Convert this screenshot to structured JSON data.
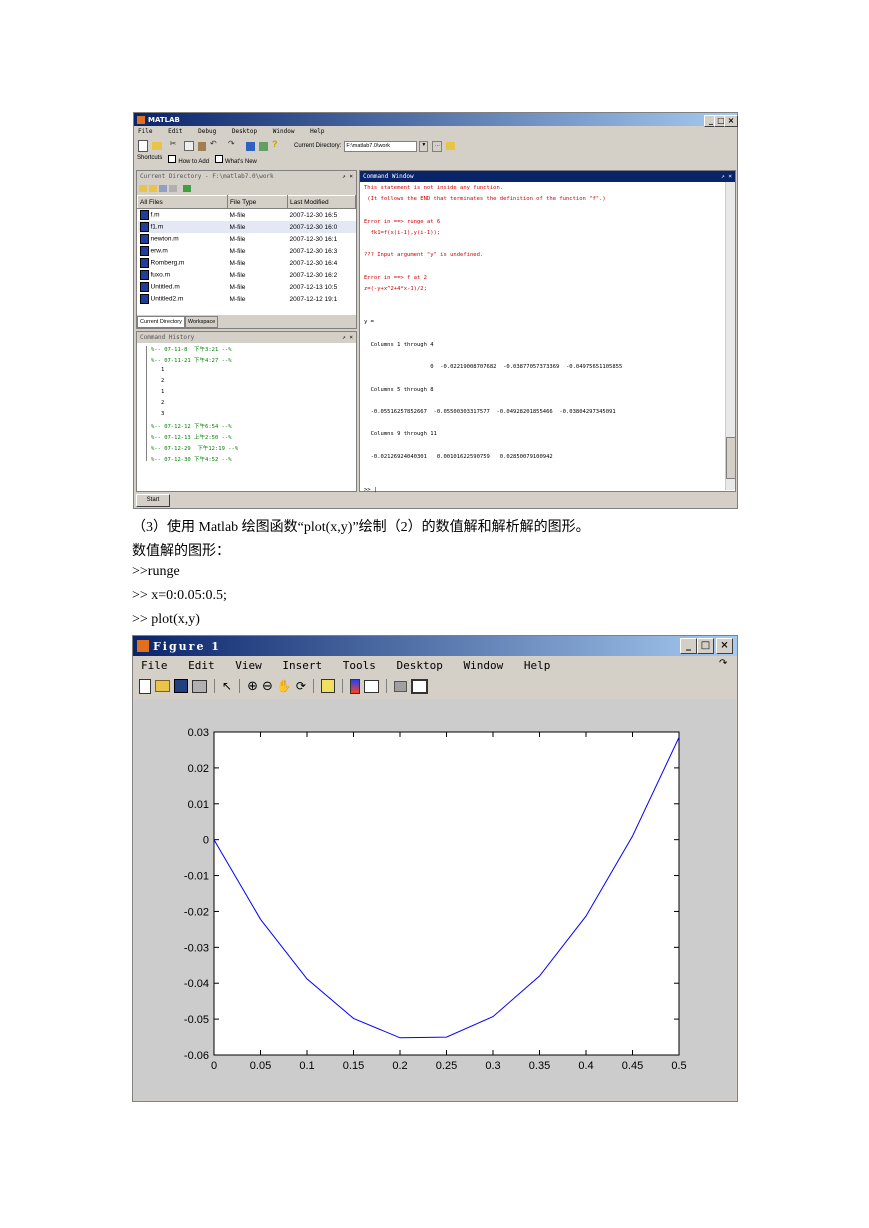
{
  "matlab": {
    "title": "MATLAB",
    "menu": [
      "File",
      "Edit",
      "Debug",
      "Desktop",
      "Window",
      "Help"
    ],
    "current_directory_label": "Current Directory:",
    "current_directory_value": "F:\\matlab7.0\\work",
    "shortcuts": [
      "Shortcuts",
      "How to Add",
      "What's New"
    ],
    "current_dir_panel_title": "Current Directory - F:\\matlab7.0\\work",
    "file_columns": [
      "All Files",
      "File Type",
      "Last Modified"
    ],
    "files": [
      {
        "name": "f.m",
        "type": "M-file",
        "modified": "2007-12-30 16:5"
      },
      {
        "name": "f1.m",
        "type": "M-file",
        "modified": "2007-12-30 16:0"
      },
      {
        "name": "newton.m",
        "type": "M-file",
        "modified": "2007-12-30 16:1"
      },
      {
        "name": "erw.m",
        "type": "M-file",
        "modified": "2007-12-30 16:3"
      },
      {
        "name": "Romberg.m",
        "type": "M-file",
        "modified": "2007-12-30 16:4"
      },
      {
        "name": "fuxo.m",
        "type": "M-file",
        "modified": "2007-12-30 16:2"
      },
      {
        "name": "Untitled.m",
        "type": "M-file",
        "modified": "2007-12-13 10:5"
      },
      {
        "name": "Untitled2.m",
        "type": "M-file",
        "modified": "2007-12-12 19:1"
      }
    ],
    "panel_tabs": [
      "Current Directory",
      "Workspace"
    ],
    "history_title": "Command History",
    "history": [
      "%-- 07-11-8  下午3:21 --%",
      "%-- 07-11-21 下午4:27 --%",
      "1",
      "2",
      "1",
      "2",
      "3",
      "%-- 07-12-12 下午6:54 --%",
      "%-- 07-12-13 上午2:50 --%",
      "%-- 07-12-29  下午12:19 --%",
      "%-- 07-12-30 下午4:52 --%"
    ],
    "command_title": "Command Window",
    "command_lines": [
      {
        "text": "This statement is not inside any function.",
        "red": true
      },
      {
        "text": " (It follows the END that terminates the definition of the function \"f\".)",
        "red": true
      },
      {
        "text": "",
        "red": false
      },
      {
        "text": "Error in ==> runge at 6",
        "red": true
      },
      {
        "text": "  fk1=f(x(i-1),y(i-1));",
        "red": true
      },
      {
        "text": "",
        "red": false
      },
      {
        "text": "??? Input argument \"y\" is undefined.",
        "red": true
      },
      {
        "text": "",
        "red": false
      },
      {
        "text": "Error in ==> f at 2",
        "red": true
      },
      {
        "text": "z=(-y+x^2+4*x-1)/2;",
        "red": true
      },
      {
        "text": "",
        "red": false
      },
      {
        "text": "",
        "red": false
      },
      {
        "text": "y =",
        "red": false
      },
      {
        "text": "",
        "red": false
      },
      {
        "text": "  Columns 1 through 4",
        "red": false
      },
      {
        "text": "",
        "red": false
      },
      {
        "text": "                    0  -0.02219008707682  -0.03877057373369  -0.04975651105855",
        "red": false
      },
      {
        "text": "",
        "red": false
      },
      {
        "text": "  Columns 5 through 8",
        "red": false
      },
      {
        "text": "",
        "red": false
      },
      {
        "text": "  -0.05516257852667  -0.05500303317577  -0.04928201855466  -0.03804297345091",
        "red": false
      },
      {
        "text": "",
        "red": false
      },
      {
        "text": "  Columns 9 through 11",
        "red": false
      },
      {
        "text": "",
        "red": false
      },
      {
        "text": "  -0.02126924040301   0.00101622590759   0.02850079100942",
        "red": false
      },
      {
        "text": "",
        "red": false
      },
      {
        "text": "",
        "red": false
      },
      {
        "text": ">> |",
        "red": false
      }
    ],
    "start_label": "Start"
  },
  "doc": {
    "line1": "（3）使用 Matlab 绘图函数“plot(x,y)”绘制（2）的数值解和解析解的图形。",
    "line2": "数值解的图形：",
    "line3": ">>runge",
    "line4": ">> x=0:0.05:0.5;",
    "line5": ">> plot(x,y)"
  },
  "figure": {
    "title": "Figure 1",
    "menu": [
      "File",
      "Edit",
      "View",
      "Insert",
      "Tools",
      "Desktop",
      "Window",
      "Help"
    ]
  },
  "chart_data": {
    "type": "line",
    "x": [
      0,
      0.05,
      0.1,
      0.15,
      0.2,
      0.25,
      0.3,
      0.35,
      0.4,
      0.45,
      0.5
    ],
    "series": [
      {
        "values": [
          0,
          -0.0222,
          -0.0388,
          -0.0498,
          -0.0552,
          -0.055,
          -0.0493,
          -0.038,
          -0.0213,
          0.001,
          0.0285
        ],
        "color": "#0000ff"
      }
    ],
    "xlim": [
      0,
      0.5
    ],
    "ylim": [
      -0.06,
      0.03
    ],
    "xticks": [
      "0",
      "0.05",
      "0.1",
      "0.15",
      "0.2",
      "0.25",
      "0.3",
      "0.35",
      "0.4",
      "0.45",
      "0.5"
    ],
    "yticks": [
      "-0.06",
      "-0.05",
      "-0.04",
      "-0.03",
      "-0.02",
      "-0.01",
      "0",
      "0.01",
      "0.02",
      "0.03"
    ],
    "grid": false
  }
}
